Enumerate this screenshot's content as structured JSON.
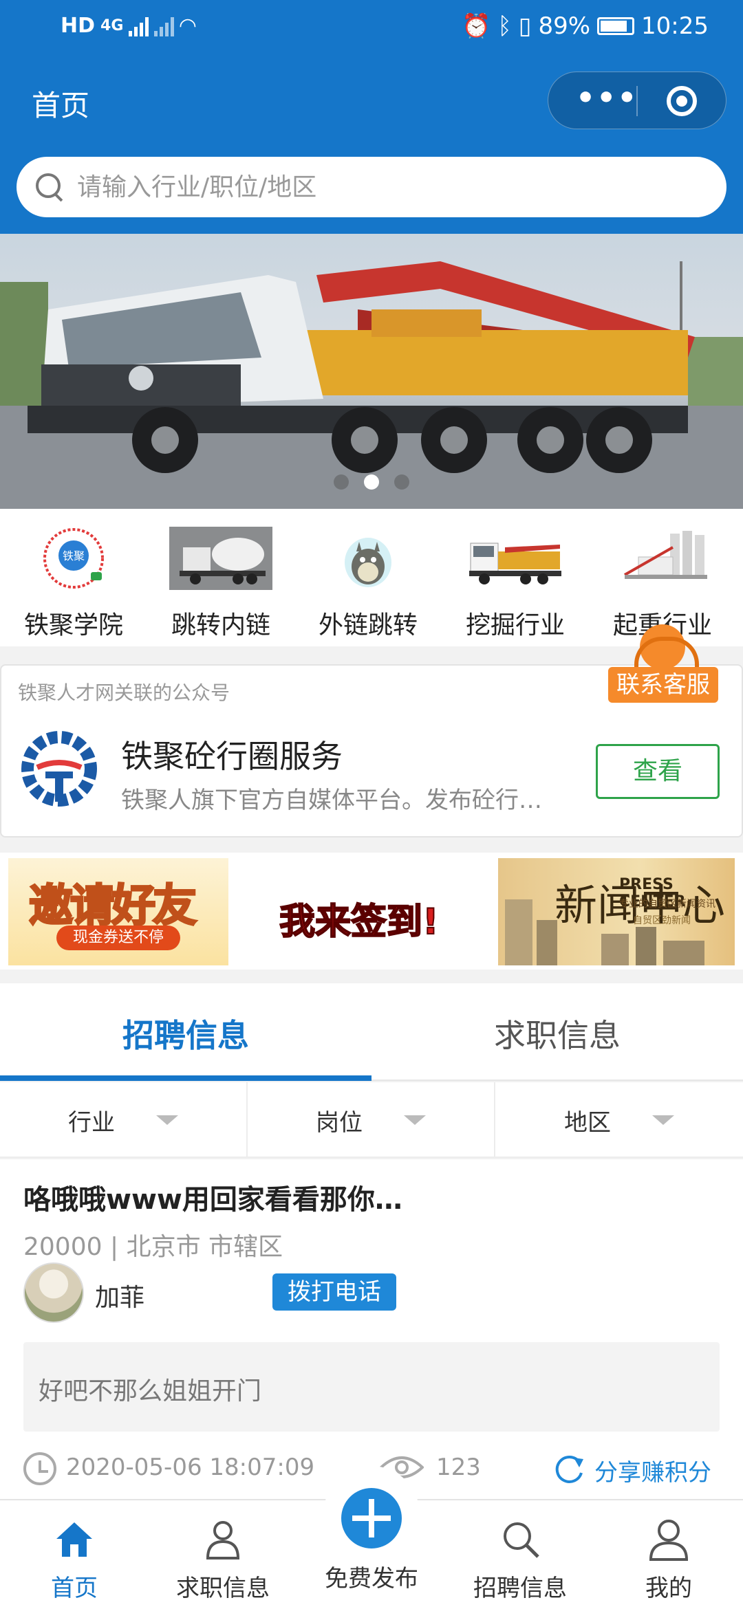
{
  "status_bar": {
    "left_icons": "HD",
    "network": "4G",
    "battery": "89%",
    "time": "10:25"
  },
  "nav": {
    "title": "首页",
    "more_icon": "more-dots-icon",
    "close_icon": "target-circle-icon"
  },
  "search": {
    "placeholder": "请输入行业/职位/地区",
    "icon": "search-icon"
  },
  "banner": {
    "slides": 3,
    "active_index": 1
  },
  "categories": [
    {
      "label": "铁聚学院",
      "icon": "academy-logo"
    },
    {
      "label": "跳转内链",
      "icon": "mixer-truck-image"
    },
    {
      "label": "外链跳转",
      "icon": "totoro-image"
    },
    {
      "label": "挖掘行业",
      "icon": "pump-truck-image"
    },
    {
      "label": "起重行业",
      "icon": "silo-plant-image"
    }
  ],
  "customer_service": {
    "label": "联系客服",
    "icon": "headset-agent-icon"
  },
  "official_account": {
    "subtitle": "铁聚人才网关联的公众号",
    "name": "铁聚砼行圈服务",
    "description": "铁聚人旗下官方自媒体平台。发布砼行…",
    "button": "查看"
  },
  "promos": {
    "invite": {
      "title": "邀请好友",
      "subtitle": "现金券送不停"
    },
    "checkin": {
      "title": "我来签到!"
    },
    "news": {
      "big": "新闻中心",
      "en": "PRESS CENTER",
      "small": "专业的自贸区新闻资讯",
      "tag": "自贸区劲新闻"
    }
  },
  "tabs": {
    "active": "招聘信息",
    "inactive": "求职信息"
  },
  "filters": [
    {
      "label": "行业"
    },
    {
      "label": "岗位"
    },
    {
      "label": "地区"
    }
  ],
  "job": {
    "title": "咯哦哦www用回家看看那你…",
    "salary": "20000",
    "location": "北京市 市辖区",
    "poster": "加菲",
    "call_button": "拨打电话",
    "description": "好吧不那么姐姐开门",
    "time": "2020-05-06 18:07:09",
    "views": "123",
    "share": "分享赚积分"
  },
  "tabbar": [
    {
      "label": "首页",
      "icon": "home-icon",
      "active": true
    },
    {
      "label": "求职信息",
      "icon": "person-icon",
      "active": false
    },
    {
      "label": "免费发布",
      "icon": "plus-icon",
      "active": false
    },
    {
      "label": "招聘信息",
      "icon": "search-doc-icon",
      "active": false
    },
    {
      "label": "我的",
      "icon": "user-icon",
      "active": false
    }
  ],
  "colors": {
    "primary": "#1576c9",
    "accent_green": "#2ea34a",
    "accent_orange": "#f58a2b"
  }
}
